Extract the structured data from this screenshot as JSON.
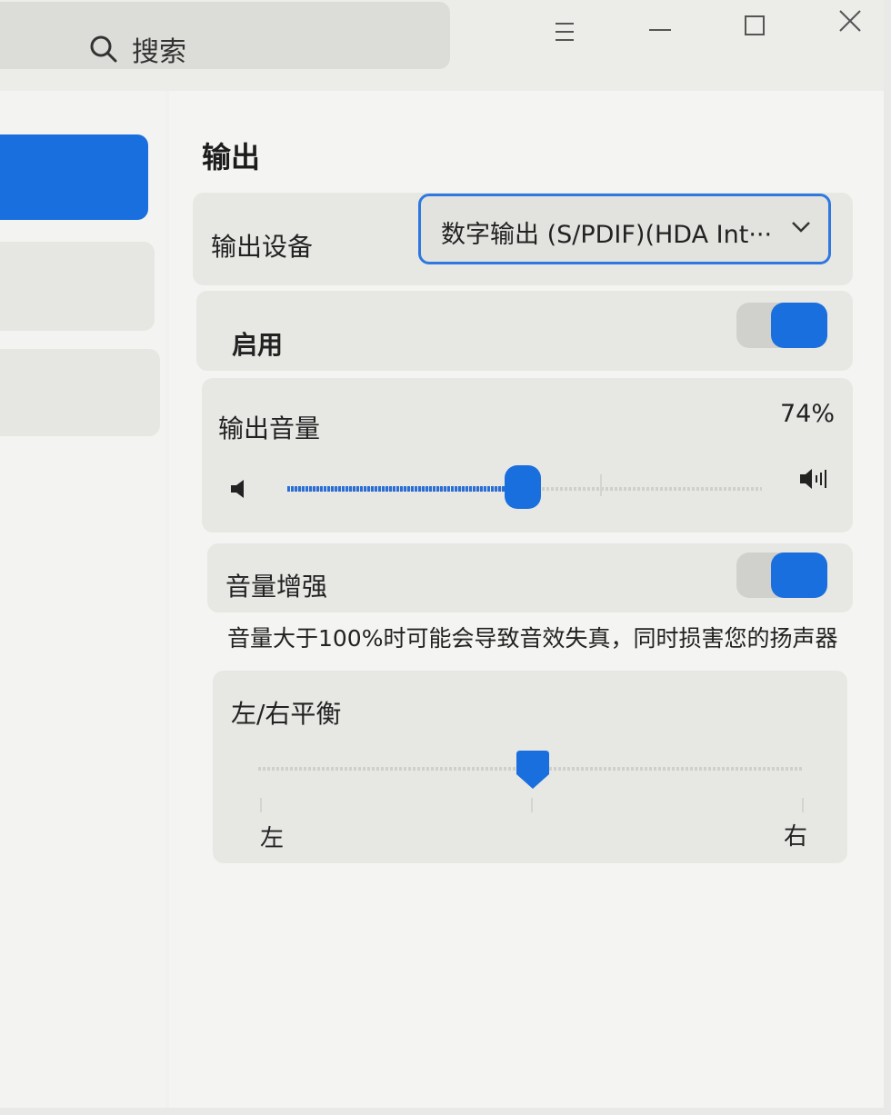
{
  "search": {
    "label": "搜索"
  },
  "output": {
    "title": "输出",
    "device_label": "输出设备",
    "device_value": "数字输出 (S/PDIF)(HDA Int···",
    "enable_label": "启用",
    "enable_on": true,
    "volume_label": "输出音量",
    "volume_percent": "74%",
    "volume_level": 0.74,
    "boost_label": "音量增强",
    "boost_on": true,
    "boost_hint": "音量大于100%时可能会导致音效失真，同时损害您的扬声器",
    "balance_label": "左/右平衡",
    "balance_left": "左",
    "balance_right": "右",
    "balance_level": 0.5
  },
  "colors": {
    "accent": "#1a6fde",
    "card": "#e7e7e4",
    "background": "#f4f4f2"
  }
}
